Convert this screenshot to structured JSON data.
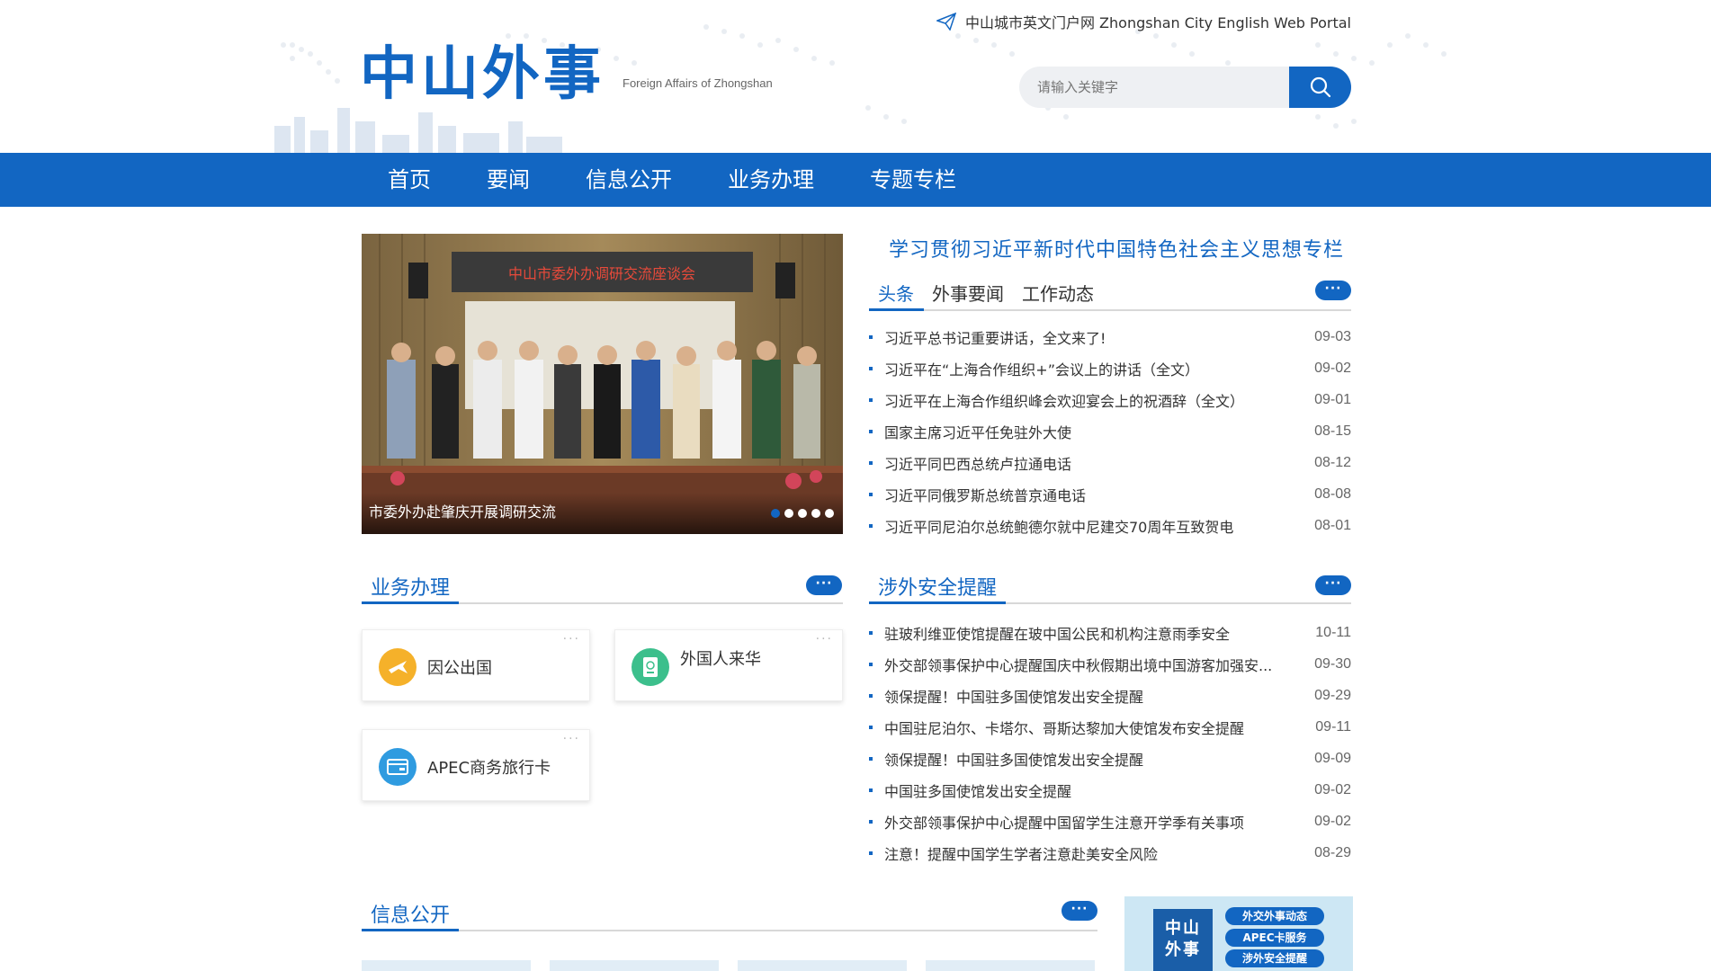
{
  "header": {
    "portal_link": "中山城市英文门户网  Zhongshan City English Web Portal",
    "logo_main": "中山外事",
    "logo_sub": "Foreign Affairs of Zhongshan",
    "search_placeholder": "请输入关键字"
  },
  "nav": {
    "items": [
      "首页",
      "要闻",
      "信息公开",
      "业务办理",
      "专题专栏"
    ]
  },
  "carousel": {
    "banner_text": "中山市委外办调研交流座谈会",
    "caption": "市委外办赴肇庆开展调研交流",
    "slide_count": 5,
    "active_index": 0
  },
  "featured": {
    "title": "学习贯彻习近平新时代中国特色社会主义思想专栏",
    "tabs": [
      "头条",
      "外事要闻",
      "工作动态"
    ],
    "active_tab": "头条",
    "more": "···",
    "items": [
      {
        "title": "习近平总书记重要讲话，全文来了!",
        "date": "09-03"
      },
      {
        "title": "习近平在“上海合作组织+”会议上的讲话（全文）",
        "date": "09-02"
      },
      {
        "title": "习近平在上海合作组织峰会欢迎宴会上的祝酒辞（全文）",
        "date": "09-01"
      },
      {
        "title": "国家主席习近平任免驻外大使",
        "date": "08-15"
      },
      {
        "title": "习近平同巴西总统卢拉通电话",
        "date": "08-12"
      },
      {
        "title": "习近平同俄罗斯总统普京通电话",
        "date": "08-08"
      },
      {
        "title": "习近平同尼泊尔总统鲍德尔就中尼建交70周年互致贺电",
        "date": "08-01"
      }
    ]
  },
  "services": {
    "title": "业务办理",
    "more": "···",
    "cards": [
      {
        "label": "因公出国",
        "icon": "plane-icon",
        "color": "#f5b12a"
      },
      {
        "label": "外国人来华",
        "icon": "passport-icon",
        "color": "#3cbf8c"
      },
      {
        "label": "APEC商务旅行卡",
        "icon": "card-icon",
        "color": "#2f9be0"
      }
    ]
  },
  "safety": {
    "title": "涉外安全提醒",
    "more": "···",
    "items": [
      {
        "title": "驻玻利维亚使馆提醒在玻中国公民和机构注意雨季安全",
        "date": "10-11"
      },
      {
        "title": "外交部领事保护中心提醒国庆中秋假期出境中国游客加强安...",
        "date": "09-30"
      },
      {
        "title": "领保提醒！中国驻多国使馆发出安全提醒",
        "date": "09-29"
      },
      {
        "title": "中国驻尼泊尔、卡塔尔、哥斯达黎加大使馆发布安全提醒",
        "date": "09-11"
      },
      {
        "title": "领保提醒！中国驻多国使馆发出安全提醒",
        "date": "09-09"
      },
      {
        "title": "中国驻多国使馆发出安全提醒",
        "date": "09-02"
      },
      {
        "title": "外交部领事保护中心提醒中国留学生注意开学季有关事项",
        "date": "09-02"
      },
      {
        "title": "注意！提醒中国学生学者注意赴美安全风险",
        "date": "08-29"
      }
    ]
  },
  "info": {
    "title": "信息公开",
    "more": "···"
  },
  "promo": {
    "logo_line1": "中山",
    "logo_line2": "外事",
    "pills": [
      "外交外事动态",
      "APEC卡服务",
      "涉外安全提醒"
    ]
  },
  "colors": {
    "brand": "#1266c2",
    "nav_bg": "#1266c2",
    "promo_bg": "#cde7f4"
  }
}
